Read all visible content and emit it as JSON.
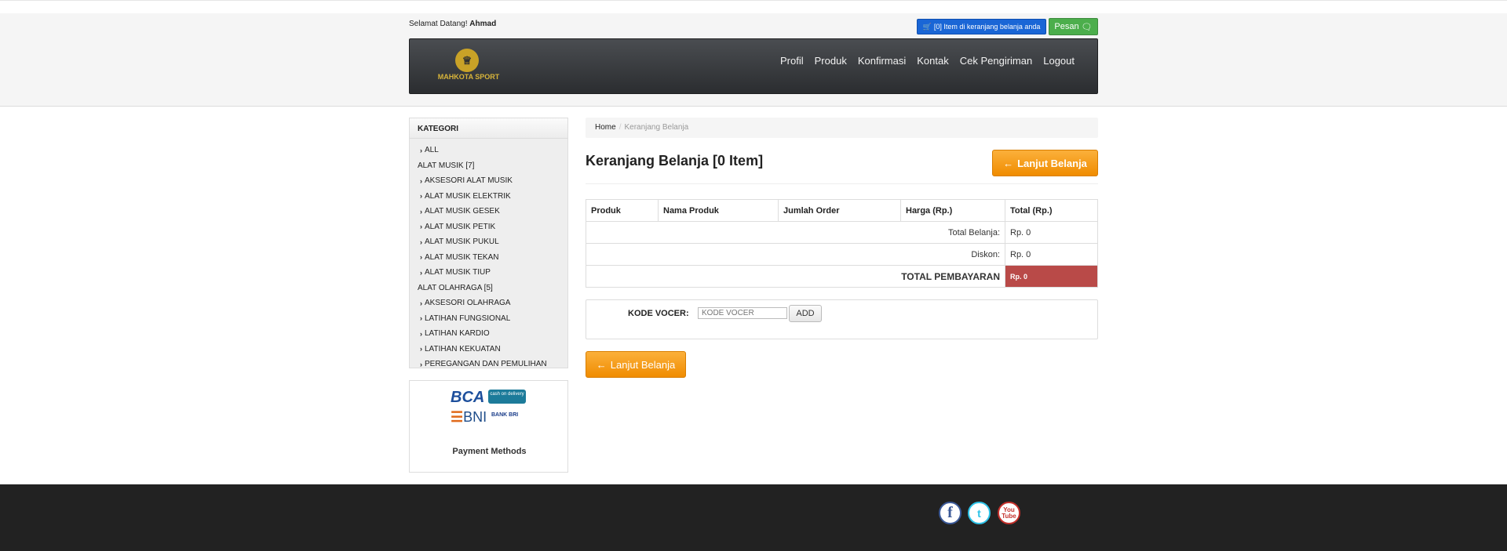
{
  "header": {
    "welcome_prefix": "Selamat Datang!",
    "username": "Ahmad",
    "cart_button": "[0] Item di keranjang belanja anda",
    "pesan_button": "Pesan",
    "logo_text": "MAHKOTA SPORT",
    "nav": [
      "Profil",
      "Produk",
      "Konfirmasi",
      "Kontak",
      "Cek Pengiriman",
      "Logout"
    ]
  },
  "sidebar": {
    "heading": "KATEGORI",
    "items": [
      {
        "label": "ALL",
        "type": "sub"
      },
      {
        "label": "ALAT MUSIK [7]",
        "type": "group"
      },
      {
        "label": "AKSESORI ALAT MUSIK",
        "type": "sub"
      },
      {
        "label": "ALAT MUSIK ELEKTRIK",
        "type": "sub"
      },
      {
        "label": "ALAT MUSIK GESEK",
        "type": "sub"
      },
      {
        "label": "ALAT MUSIK PETIK",
        "type": "sub"
      },
      {
        "label": "ALAT MUSIK PUKUL",
        "type": "sub"
      },
      {
        "label": "ALAT MUSIK TEKAN",
        "type": "sub"
      },
      {
        "label": "ALAT MUSIK TIUP",
        "type": "sub"
      },
      {
        "label": "ALAT OLAHRAGA [5]",
        "type": "group"
      },
      {
        "label": "AKSESORI OLAHRAGA",
        "type": "sub"
      },
      {
        "label": "LATIHAN FUNGSIONAL",
        "type": "sub"
      },
      {
        "label": "LATIHAN KARDIO",
        "type": "sub"
      },
      {
        "label": "LATIHAN KEKUATAN",
        "type": "sub"
      },
      {
        "label": "PEREGANGAN DAN PEMULIHAN",
        "type": "sub"
      }
    ],
    "payment": {
      "bca": "BCA",
      "cod": "cash on delivery",
      "bni": "BNI",
      "bri": "BANK BRI",
      "label": "Payment Methods"
    }
  },
  "breadcrumb": {
    "home": "Home",
    "current": "Keranjang Belanja"
  },
  "main": {
    "title": "Keranjang Belanja [0 Item]",
    "continue_button": "Lanjut Belanja",
    "table": {
      "headers": [
        "Produk",
        "Nama Produk",
        "Jumlah Order",
        "Harga (Rp.)",
        "Total (Rp.)"
      ],
      "total_belanja_label": "Total Belanja:",
      "total_belanja_value": "Rp. 0",
      "diskon_label": "Diskon:",
      "diskon_value": "Rp. 0",
      "total_pembayaran_label": "TOTAL PEMBAYARAN",
      "total_pembayaran_value": "Rp. 0"
    },
    "voucher": {
      "label": "KODE VOCER:",
      "placeholder": "KODE VOCER",
      "add_button": "ADD"
    }
  },
  "footer": {
    "social": {
      "facebook": "f",
      "twitter": "t",
      "youtube_top": "You",
      "youtube_bottom": "Tube"
    }
  }
}
